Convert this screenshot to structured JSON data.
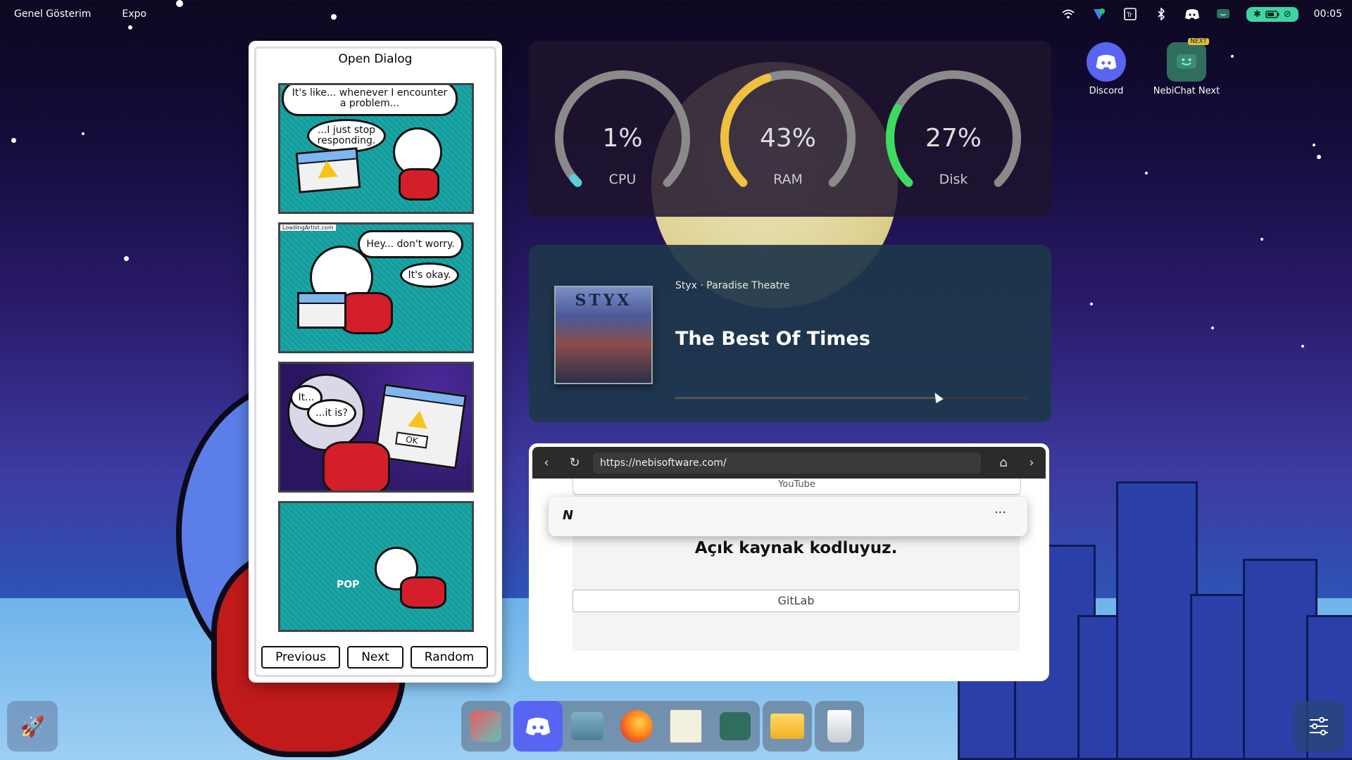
{
  "topbar": {
    "menu": [
      "Genel Gösterim",
      "Expo"
    ],
    "clock": "00:05",
    "tray_icons": [
      "wifi-icon",
      "vpn-shield-icon",
      "translate-icon",
      "bluetooth-icon",
      "discord-tray-icon",
      "nebichat-tray-icon"
    ],
    "battery_icons": [
      "bluetooth-icon",
      "battery-icon",
      "do-not-disturb-icon"
    ]
  },
  "desktop_icons": [
    {
      "label": "Discord",
      "icon": "discord-icon",
      "color": "#5865f2"
    },
    {
      "label": "NebiChat Next",
      "icon": "nebichat-icon",
      "badge": "NEXT",
      "color": "#2f6d5e"
    }
  ],
  "comic": {
    "title": "Open Dialog",
    "panel1": {
      "bubble1": "It's like... whenever I encounter a problem...",
      "bubble2": "...I just stop responding."
    },
    "panel2": {
      "watermark": "LoadingArtist.com",
      "bubble1": "Hey... don't worry.",
      "bubble2": "It's okay."
    },
    "panel3": {
      "bubble1": "It...",
      "bubble2": "...it is?",
      "ok": "OK"
    },
    "panel4": {
      "sfx": "POP"
    },
    "buttons": {
      "previous": "Previous",
      "next": "Next",
      "random": "Random"
    }
  },
  "sysmon": {
    "gauges": [
      {
        "label": "CPU",
        "value": "1%",
        "fraction": 0.01,
        "color": "#5ad0d8"
      },
      {
        "label": "RAM",
        "value": "43%",
        "fraction": 0.43,
        "color": "#f0c040"
      },
      {
        "label": "Disk",
        "value": "27%",
        "fraction": 0.27,
        "color": "#3cdc60"
      }
    ]
  },
  "music": {
    "meta": "Styx · Paradise Theatre",
    "title": "The Best Of Times",
    "cover_text": "STYX",
    "progress": 0.74
  },
  "browser": {
    "url": "https://nebisoftware.com/",
    "partial_link": "YouTube",
    "logo": "N",
    "menu": "···",
    "headline": "Açık kaynak kodluyuz.",
    "link": "GitLab"
  },
  "dock": {
    "items": [
      "color-picker-icon",
      "discord-icon",
      "archive-icon",
      "firefox-icon",
      "text-editor-icon",
      "nebichat-icon",
      "files-icon",
      "trash-icon"
    ]
  }
}
